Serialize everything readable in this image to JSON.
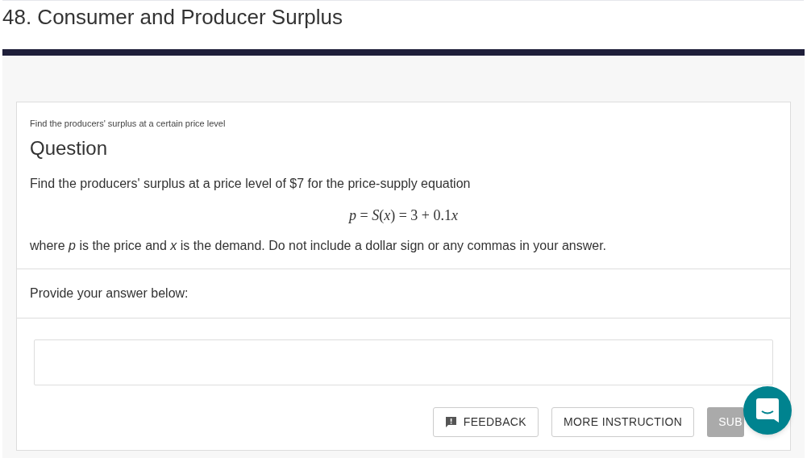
{
  "page_title": "48. Consumer and Producer Surplus",
  "question": {
    "subtitle": "Find the producers' surplus at a certain price level",
    "heading": "Question",
    "text": "Find the producers' surplus at a price level of $7 for the price-supply equation",
    "formula": [
      {
        "t": "p",
        "italic": true
      },
      {
        "t": " = ",
        "italic": false
      },
      {
        "t": "S",
        "italic": true
      },
      {
        "t": "(",
        "italic": false
      },
      {
        "t": "x",
        "italic": true
      },
      {
        "t": ") = 3 + 0.1",
        "italic": false
      },
      {
        "t": "x",
        "italic": true
      }
    ],
    "note": "where *p* is the price and *x* is the demand. Do not include a dollar sign or any commas in your answer."
  },
  "answer": {
    "prompt": "Provide your answer below:"
  },
  "buttons": [
    {
      "kind": "feedback",
      "label": "FEEDBACK"
    },
    {
      "kind": "outline",
      "label": "MORE INSTRUCTION"
    },
    {
      "kind": "submit",
      "label": "SUB",
      "disabled": true
    }
  ]
}
